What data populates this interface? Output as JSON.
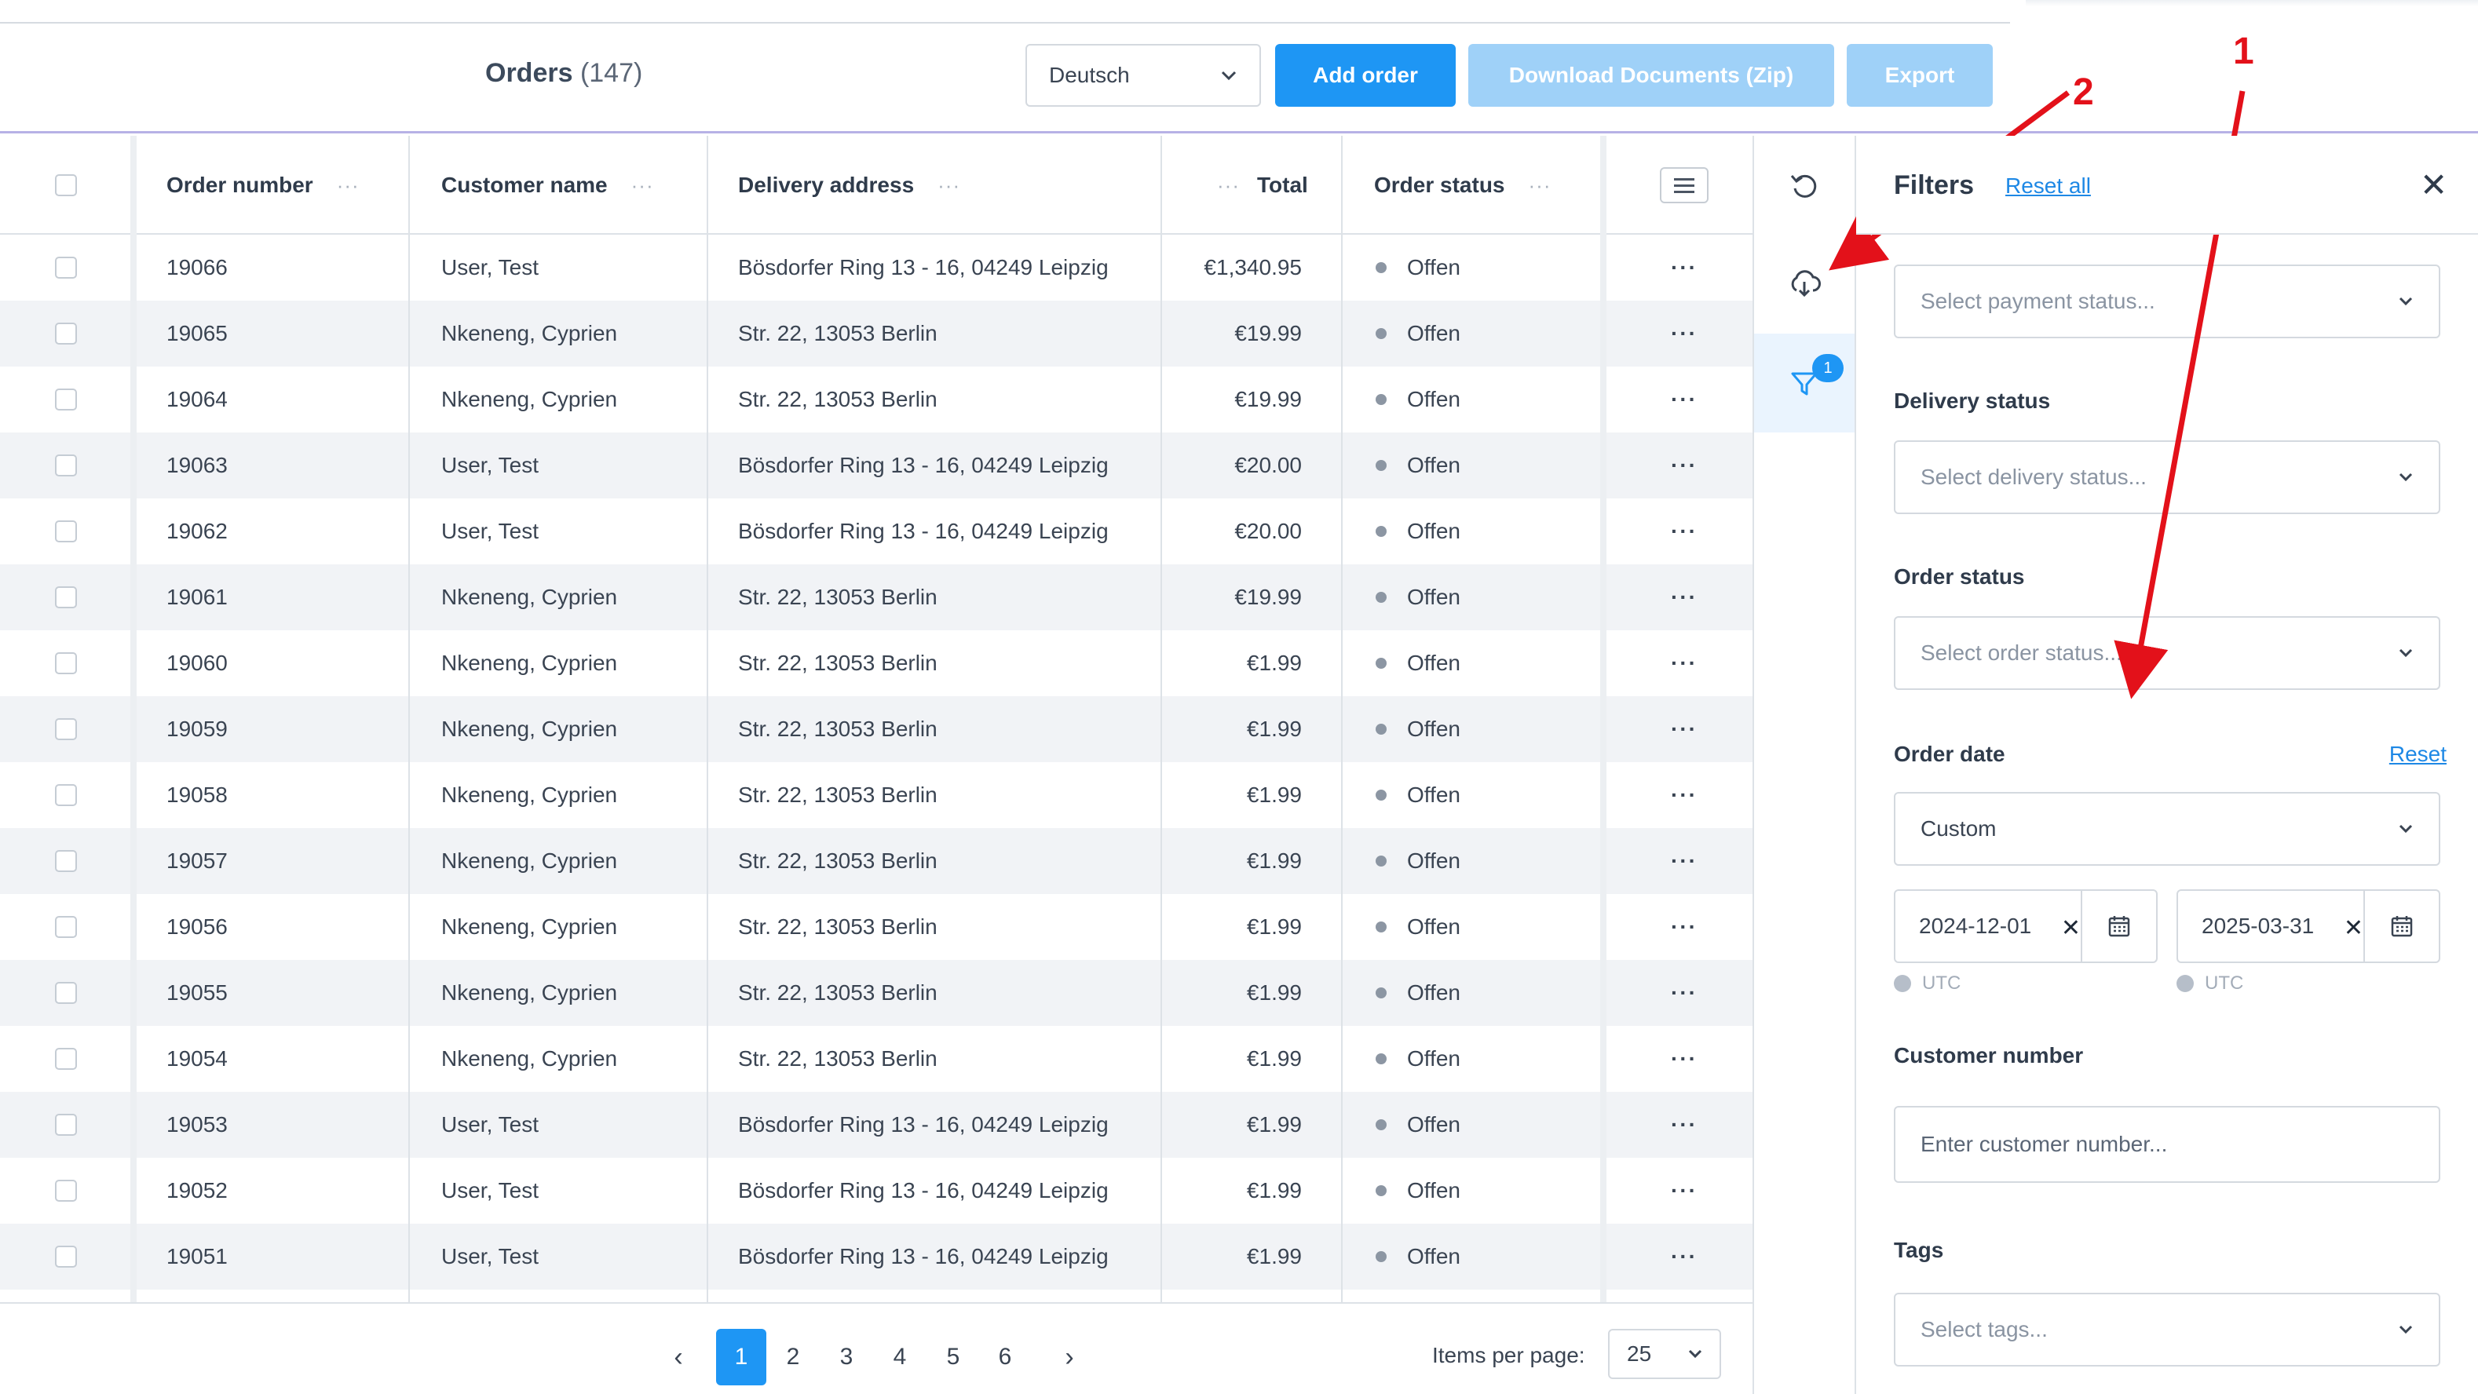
{
  "header": {
    "title": "Orders",
    "count": "(147)",
    "language": "Deutsch",
    "add_order": "Add order",
    "download_documents": "Download Documents (Zip)",
    "export": "Export"
  },
  "table": {
    "columns": {
      "order_number": "Order number",
      "customer_name": "Customer name",
      "delivery_address": "Delivery address",
      "total": "Total",
      "order_status": "Order status"
    },
    "column_dots": "···",
    "row_menu": "···",
    "rows": [
      {
        "order": "19066",
        "customer": "User, Test",
        "address": "Bösdorfer Ring 13 - 16, 04249 Leipzig",
        "total": "€1,340.95",
        "status": "Offen"
      },
      {
        "order": "19065",
        "customer": "Nkeneng, Cyprien",
        "address": "Str. 22, 13053 Berlin",
        "total": "€19.99",
        "status": "Offen"
      },
      {
        "order": "19064",
        "customer": "Nkeneng, Cyprien",
        "address": "Str. 22, 13053 Berlin",
        "total": "€19.99",
        "status": "Offen"
      },
      {
        "order": "19063",
        "customer": "User, Test",
        "address": "Bösdorfer Ring 13 - 16, 04249 Leipzig",
        "total": "€20.00",
        "status": "Offen"
      },
      {
        "order": "19062",
        "customer": "User, Test",
        "address": "Bösdorfer Ring 13 - 16, 04249 Leipzig",
        "total": "€20.00",
        "status": "Offen"
      },
      {
        "order": "19061",
        "customer": "Nkeneng, Cyprien",
        "address": "Str. 22, 13053 Berlin",
        "total": "€19.99",
        "status": "Offen"
      },
      {
        "order": "19060",
        "customer": "Nkeneng, Cyprien",
        "address": "Str. 22, 13053 Berlin",
        "total": "€1.99",
        "status": "Offen"
      },
      {
        "order": "19059",
        "customer": "Nkeneng, Cyprien",
        "address": "Str. 22, 13053 Berlin",
        "total": "€1.99",
        "status": "Offen"
      },
      {
        "order": "19058",
        "customer": "Nkeneng, Cyprien",
        "address": "Str. 22, 13053 Berlin",
        "total": "€1.99",
        "status": "Offen"
      },
      {
        "order": "19057",
        "customer": "Nkeneng, Cyprien",
        "address": "Str. 22, 13053 Berlin",
        "total": "€1.99",
        "status": "Offen"
      },
      {
        "order": "19056",
        "customer": "Nkeneng, Cyprien",
        "address": "Str. 22, 13053 Berlin",
        "total": "€1.99",
        "status": "Offen"
      },
      {
        "order": "19055",
        "customer": "Nkeneng, Cyprien",
        "address": "Str. 22, 13053 Berlin",
        "total": "€1.99",
        "status": "Offen"
      },
      {
        "order": "19054",
        "customer": "Nkeneng, Cyprien",
        "address": "Str. 22, 13053 Berlin",
        "total": "€1.99",
        "status": "Offen"
      },
      {
        "order": "19053",
        "customer": "User, Test",
        "address": "Bösdorfer Ring 13 - 16, 04249 Leipzig",
        "total": "€1.99",
        "status": "Offen"
      },
      {
        "order": "19052",
        "customer": "User, Test",
        "address": "Bösdorfer Ring 13 - 16, 04249 Leipzig",
        "total": "€1.99",
        "status": "Offen"
      },
      {
        "order": "19051",
        "customer": "User, Test",
        "address": "Bösdorfer Ring 13 - 16, 04249 Leipzig",
        "total": "€1.99",
        "status": "Offen"
      }
    ]
  },
  "pagination": {
    "prev": "‹",
    "next": "›",
    "pages": [
      "1",
      "2",
      "3",
      "4",
      "5",
      "6"
    ],
    "current": "1",
    "items_per_page_label": "Items per page:",
    "items_per_page": "25"
  },
  "rail": {
    "icons": [
      "reset-icon",
      "cloud-download-icon",
      "filter-icon"
    ],
    "filter_badge": "1"
  },
  "filters": {
    "title": "Filters",
    "reset_all": "Reset all",
    "payment_status_placeholder": "Select payment status...",
    "delivery_status_label": "Delivery status",
    "delivery_status_placeholder": "Select delivery status...",
    "order_status_label": "Order status",
    "order_status_placeholder": "Select order status...",
    "order_date_label": "Order date",
    "order_date_reset": "Reset",
    "order_date_range": "Custom",
    "date_from": "2024-12-01",
    "date_to": "2025-03-31",
    "timezone": "UTC",
    "customer_number_label": "Customer number",
    "customer_number_placeholder": "Enter customer number...",
    "tags_label": "Tags",
    "tags_placeholder": "Select tags..."
  },
  "annotations": {
    "marker_1": "1",
    "marker_2": "2",
    "color": "#e3111a"
  },
  "colors": {
    "primary": "#1e96f4",
    "primary_disabled": "#9fd1f8",
    "link": "#1e88e5",
    "row_alt": "#f1f3f6"
  }
}
